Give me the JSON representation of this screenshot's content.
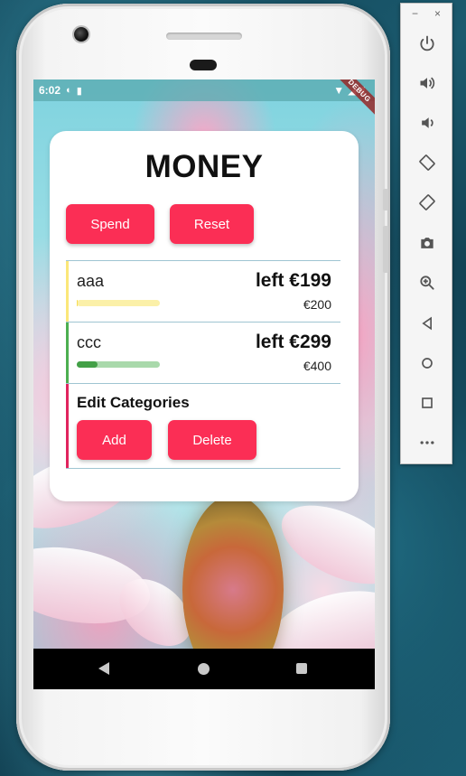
{
  "status_bar": {
    "time": "6:02",
    "debug_label": "DEBUG"
  },
  "app": {
    "title": "MONEY",
    "spend_label": "Spend",
    "reset_label": "Reset",
    "categories": [
      {
        "name": "aaa",
        "left_label": "left €199",
        "total_label": "€200",
        "bar_color": "#fbe779",
        "progress": 0.005,
        "track_color": "#fbf0a8",
        "fill_color": "#f7dd55"
      },
      {
        "name": "ccc",
        "left_label": "left €299",
        "total_label": "€400",
        "bar_color": "#4caf50",
        "progress": 0.25,
        "track_color": "#a9d9ab",
        "fill_color": "#43a047"
      }
    ],
    "edit": {
      "title": "Edit Categories",
      "add_label": "Add",
      "delete_label": "Delete",
      "bar_color": "#e0245e"
    },
    "accent_color": "#fb2e55"
  },
  "emulator_toolbar": {
    "minimize_glyph": "−",
    "close_glyph": "×",
    "buttons": [
      "power-icon",
      "volume-up-icon",
      "volume-down-icon",
      "rotate-left-icon",
      "rotate-right-icon",
      "camera-icon",
      "zoom-icon",
      "back-icon",
      "home-icon",
      "overview-icon",
      "more-icon"
    ]
  }
}
